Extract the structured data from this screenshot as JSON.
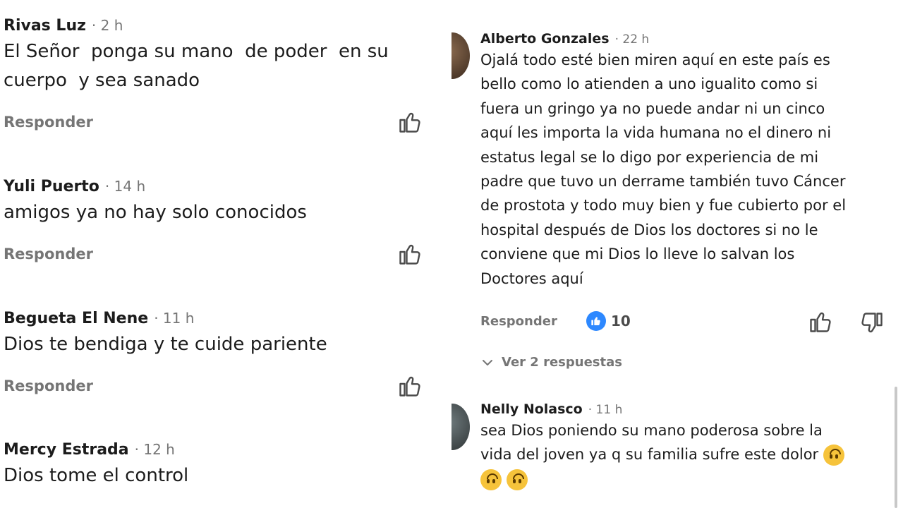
{
  "left_comments": [
    {
      "name": "Rivas Luz",
      "time": "· 2 h",
      "text": "El Señor  ponga su mano  de poder  en su\ncuerpo  y sea sanado",
      "reply": "Responder"
    },
    {
      "name": "Yuli Puerto",
      "time": "· 14 h",
      "text": "amigos ya no hay solo conocidos",
      "reply": "Responder"
    },
    {
      "name": "Begueta El Nene",
      "time": "· 11 h",
      "text": "Dios te bendiga y te cuide pariente",
      "reply": "Responder"
    },
    {
      "name": "Mercy Estrada",
      "time": "· 12 h",
      "text": "Dios tome el control"
    }
  ],
  "right_comments": [
    {
      "name": "Alberto Gonzales",
      "time": "· 22 h",
      "text": "Ojalá todo esté bien miren aquí en este país es\nbello como lo atienden a uno igualito como si\nfuera un gringo ya no puede andar ni un cinco\naquí les importa la vida humana no el dinero ni\nestatus legal se lo digo por experiencia de mi\npadre que tuvo un derrame también tuvo Cáncer\nde prostota y todo muy bien y fue cubierto por el\nhospital después de Dios los doctores si no le\nconviene que mi Dios lo lleve lo salvan los\nDoctores aquí",
      "reply": "Responder",
      "reaction_count": "10",
      "view_replies": "Ver 2 respuestas"
    },
    {
      "name": "Nelly Nolasco",
      "time": "· 11 h",
      "text": "sea Dios poniendo su mano poderosa sobre la\nvida del joven ya q su familia sufre este dolor",
      "emoji": "upside-down-face"
    }
  ],
  "colors": {
    "accent": "#2d88ff",
    "muted": "#757575",
    "text": "#1c1c1c"
  }
}
